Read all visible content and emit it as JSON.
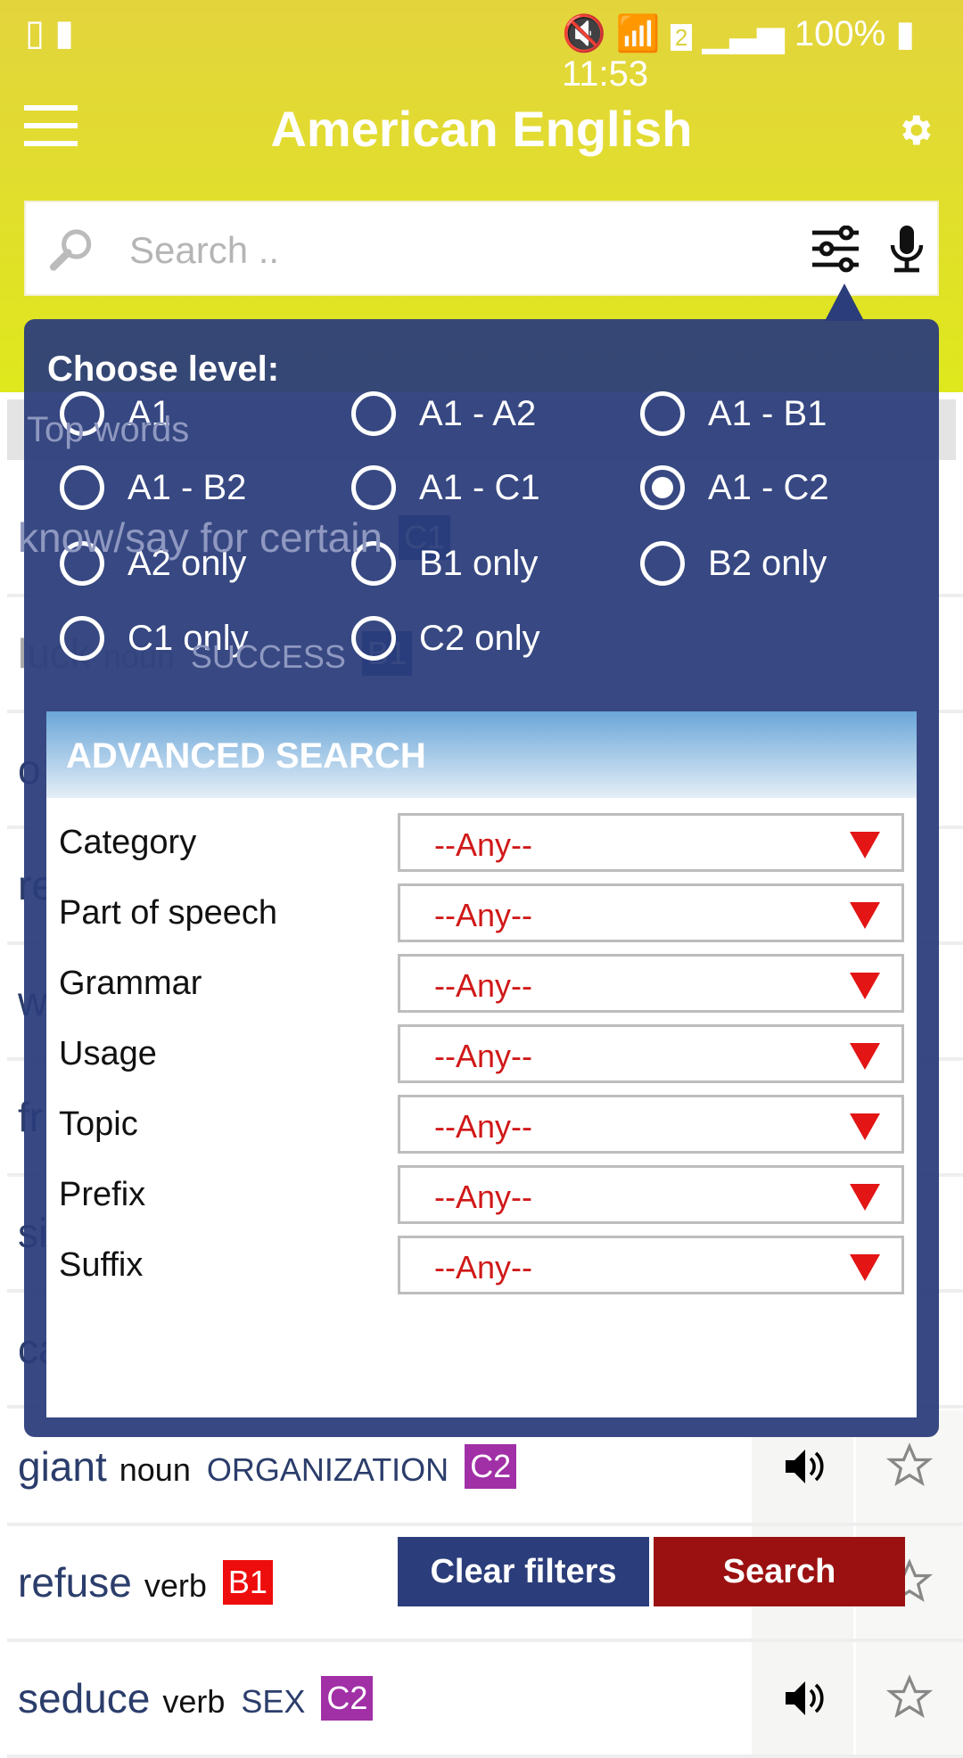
{
  "status_bar": {
    "battery": "100%",
    "time": "11:53",
    "sim": "2"
  },
  "toolbar": {
    "title": "American English",
    "menu_icon": "hamburger-icon",
    "settings_icon": "gear-icon"
  },
  "search": {
    "placeholder": "Search ..",
    "filter_icon": "sliders-icon",
    "mic_icon": "microphone-icon"
  },
  "list": {
    "header": "Top words",
    "items": [
      {
        "word": "know/say for certain",
        "pos": "",
        "topic": "",
        "level": "C1",
        "level_color": "#1f4fa0"
      },
      {
        "word": "luck",
        "pos": "noun",
        "topic": "SUCCESS",
        "level": "B1",
        "level_color": "#1f4fa0"
      },
      {
        "word": "o"
      },
      {
        "word": "re"
      },
      {
        "word": "w"
      },
      {
        "word": "fr"
      },
      {
        "word": "si"
      },
      {
        "word": "ca"
      },
      {
        "word": "giant",
        "pos": "noun",
        "topic": "ORGANIZATION",
        "level": "C2",
        "level_color": "#a12fa6"
      },
      {
        "word": "refuse",
        "pos": "verb",
        "topic": "",
        "level": "B1",
        "level_color": "#ee0d0d"
      },
      {
        "word": "seduce",
        "pos": "verb",
        "topic": "SEX",
        "level": "C2",
        "level_color": "#a12fa6"
      }
    ]
  },
  "level_filter": {
    "title": "Choose level:",
    "selected": "A1 - C2",
    "options": [
      "A1",
      "A1 - A2",
      "A1 - B1",
      "A1 - B2",
      "A1 - C1",
      "A1 - C2",
      "A2 only",
      "B1 only",
      "B2 only",
      "C1 only",
      "C2 only"
    ]
  },
  "advanced": {
    "title": "ADVANCED SEARCH",
    "fields": [
      {
        "label": "Category",
        "value": "--Any--"
      },
      {
        "label": "Part of speech",
        "value": "--Any--"
      },
      {
        "label": "Grammar",
        "value": "--Any--"
      },
      {
        "label": "Usage",
        "value": "--Any--"
      },
      {
        "label": "Topic",
        "value": "--Any--"
      },
      {
        "label": "Prefix",
        "value": "--Any--"
      },
      {
        "label": "Suffix",
        "value": "--Any--"
      }
    ],
    "clear_label": "Clear filters",
    "search_label": "Search"
  },
  "colors": {
    "accent_yellow": "#dfe81c",
    "panel_blue": "#2b3d7a",
    "search_red": "#9b1111",
    "select_red": "#d01818"
  }
}
